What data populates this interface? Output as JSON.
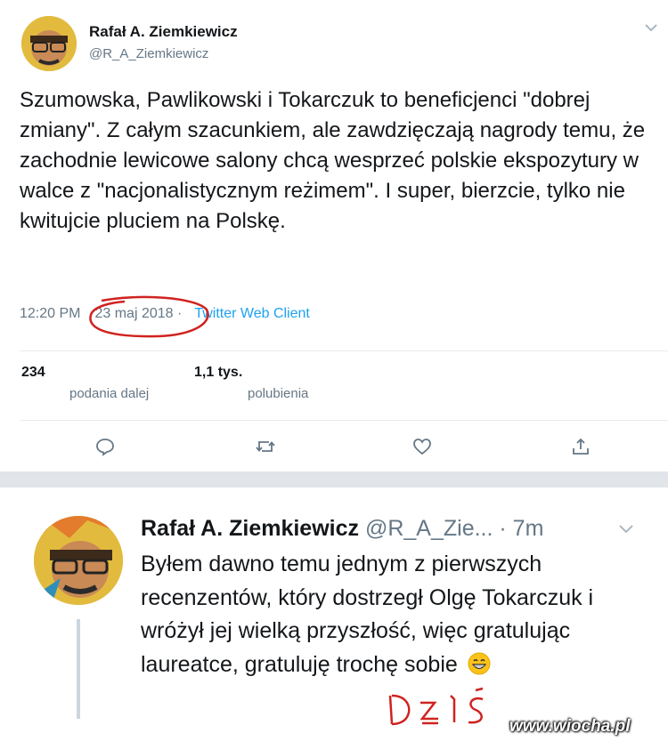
{
  "tweet1": {
    "author_name": "Rafał A. Ziemkiewicz",
    "author_handle": "@R_A_Ziemkiewicz",
    "text": "Szumowska, Pawlikowski i Tokarczuk to beneficjenci \"dobrej zmiany\". Z całym szacunkiem, ale zawdzięczają nagrody temu, że zachodnie lewicowe salony chcą wesprzeć polskie ekspozytury w walce z \"nacjonalistycznym reżimem\". I super, bierzcie, tylko nie kwitujcie pluciem na Polskę.",
    "time": "12:20 PM",
    "date": "23 maj 2018",
    "separator": "·",
    "client": "Twitter Web Client",
    "retweets_count": "234",
    "retweets_label": "podania dalej",
    "likes_count": "1,1 tys.",
    "likes_label": "polubienia",
    "actions": [
      "reply-icon",
      "retweet-icon",
      "like-icon",
      "share-icon"
    ],
    "colors": {
      "link": "#1da1f2",
      "muted": "#657786",
      "annotation": "#d0231f"
    }
  },
  "tweet2": {
    "author_name": "Rafał A. Ziemkiewicz",
    "author_handle": "@R_A_Zie...",
    "age": "· 7m",
    "text": "Byłem dawno temu jednym z pierwszych recenzentów, który dostrzegł Olgę Tokarczuk i wróżył jej wielką przyszłość, więc gratulując laureatce, gratuluję trochę sobie",
    "emoji": "grinning-face-icon",
    "annotation": "DZIŚ"
  },
  "watermark": "www.wiocha.pl"
}
